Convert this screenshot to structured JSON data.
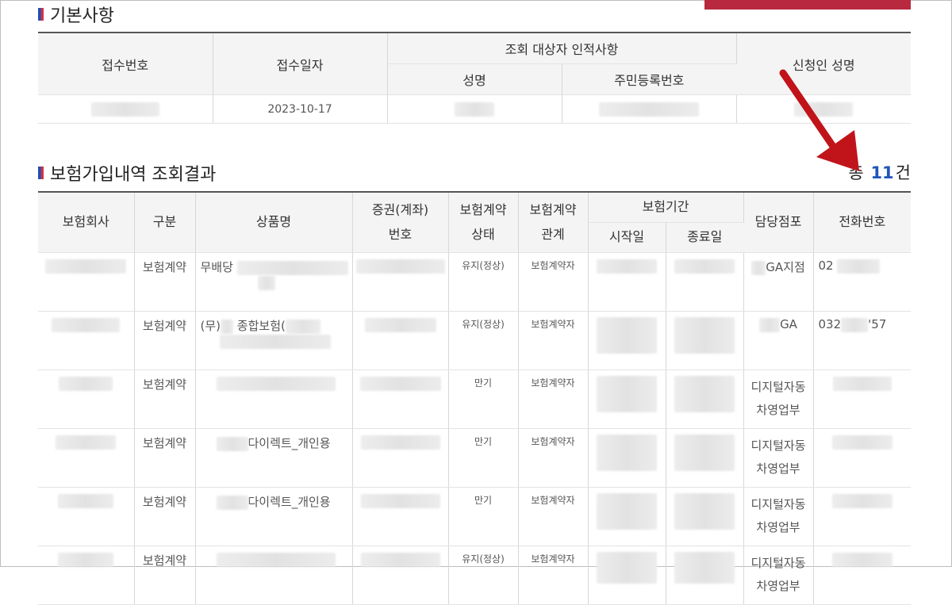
{
  "section1": {
    "title": "기본사항"
  },
  "section2": {
    "title": "보험가입내역 조회결과",
    "total_prefix": "총",
    "total_count": "11",
    "total_suffix": "건"
  },
  "basic_table": {
    "headers": {
      "receipt_no": "접수번호",
      "receipt_date": "접수일자",
      "target_group": "조회 대상자 인적사항",
      "name": "성명",
      "resident_no": "주민등록번호",
      "applicant": "신청인 성명"
    },
    "row": {
      "receipt_date": "2023-10-17"
    }
  },
  "result_table": {
    "headers": {
      "company": "보험회사",
      "category": "구분",
      "product": "상품명",
      "policy_no_line1": "증권(계좌)",
      "policy_no_line2": "번호",
      "status_line1": "보험계약",
      "status_line2": "상태",
      "relation_line1": "보험계약",
      "relation_line2": "관계",
      "period": "보험기간",
      "start": "시작일",
      "end": "종료일",
      "branch": "담당점포",
      "phone": "전화번호"
    },
    "rows": [
      {
        "category": "보험계약",
        "product": "무배당",
        "status": "유지(정상)",
        "relation": "보험계약자",
        "branch": "GA지점",
        "phone": "02"
      },
      {
        "category": "보험계약",
        "product": "(무)",
        "product_mid": "종합보험(",
        "status": "유지(정상)",
        "relation": "보험계약자",
        "branch": "GA",
        "phone": "032",
        "phone_end": "'57"
      },
      {
        "category": "보험계약",
        "status": "만기",
        "relation": "보험계약자",
        "branch_line1": "디지털자동",
        "branch_line2": "차영업부"
      },
      {
        "category": "보험계약",
        "product": "다이렉트_개인용",
        "status": "만기",
        "relation": "보험계약자",
        "branch_line1": "디지털자동",
        "branch_line2": "차영업부"
      },
      {
        "category": "보험계약",
        "product": "다이렉트_개인용",
        "status": "만기",
        "relation": "보험계약자",
        "branch_line1": "디지털자동",
        "branch_line2": "차영업부"
      },
      {
        "category": "보험계약",
        "status": "유지(정상)",
        "relation": "보험계약자",
        "branch_line1": "디지털자동",
        "branch_line2": "차영업부"
      }
    ]
  },
  "colors": {
    "accent_bar": "#b8283f",
    "count": "#1f57b8",
    "arrow": "#c0141a"
  }
}
